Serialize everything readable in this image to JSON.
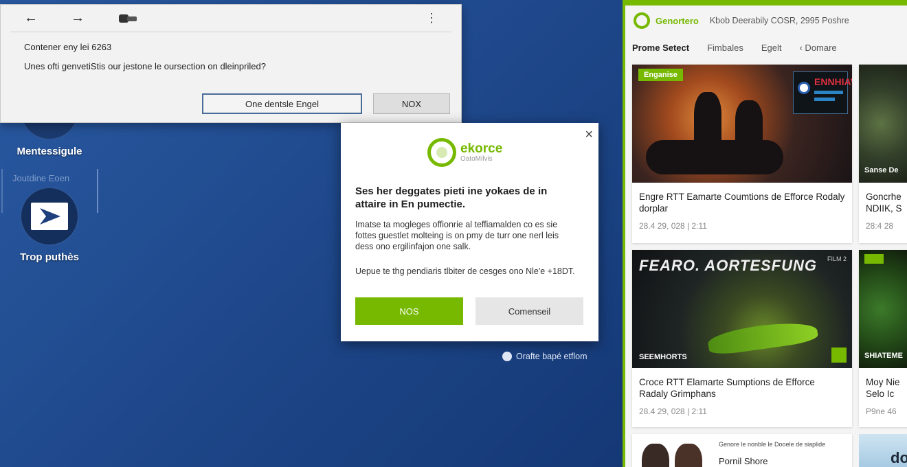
{
  "browser_dialog": {
    "nav": {
      "back_icon": "←",
      "forward_icon": "→",
      "ext_icon": "⋮"
    },
    "line1": "Contener eny lei 6263",
    "line2": "Unes ofti genvetiStis our jestone le oursection on dleinpriled?",
    "primary_button": "One dentsle Engel",
    "secondary_button": "NOX"
  },
  "desktop": {
    "icon1_label": "Mentessigule",
    "faint_label": "Joutdine Eoen",
    "icon2_label": "Trop puthès",
    "link_text": "Orafte bapé etflom"
  },
  "eforce_dialog": {
    "close_icon": "×",
    "brand": "ekorce",
    "brand_sub": "OatoMilvis",
    "title": "Ses her deggates pieti ine yokaes de in attaire in En pumectie.",
    "body1": "Imatse ta mogleges offionrie al teffiamalden co es sie fottes guestlet molteing is on pmy de turr one nerl leis dess ono ergilinfajon one salk.",
    "body2": "Uepue te thg pendiaris tlbiter de cesges ono Nle'e +18DT.",
    "ok_button": "NOS",
    "cancel_button": "Comenseil"
  },
  "panel": {
    "brand": "Genortero",
    "meta": "Kbob Deerabily COSR, 2995 Poshre",
    "tabs": [
      "Prome Setect",
      "Fimbales",
      "Egelt",
      "‹ Domare"
    ],
    "cards": [
      {
        "badge": "Enganise",
        "poster_text": "ENNHIAVG",
        "title": "Engre RTT Eamarte Coumtions de Efforce Rodaly dorplar",
        "date": "28.4 29, 028 | 2:11"
      },
      {
        "image_big_text": "FEARO. AORTESFUNG",
        "image_footer": "SEEMHORTS",
        "image_tag": "FILM 2",
        "title": "Croce RTT Elamarte Sumptions de Efforce Radaly Grimphans",
        "date": "28.4 29, 028 | 2:11"
      }
    ],
    "side_cards": [
      {
        "label": "Sanse De",
        "title": "Goncrhe NDIIK, S",
        "date": "28:4 28"
      },
      {
        "label": "SHIATEME",
        "title": "Moy Nie Selo Ic",
        "date": "P9ne 46"
      }
    ],
    "bottom_card": {
      "caption_small": "Genore le nonble le Dooele de siaplide",
      "caption": "Pornil Shore"
    },
    "bottom_tile": "do"
  },
  "colors": {
    "accent": "#76b900",
    "desktop": "#1d4688"
  }
}
